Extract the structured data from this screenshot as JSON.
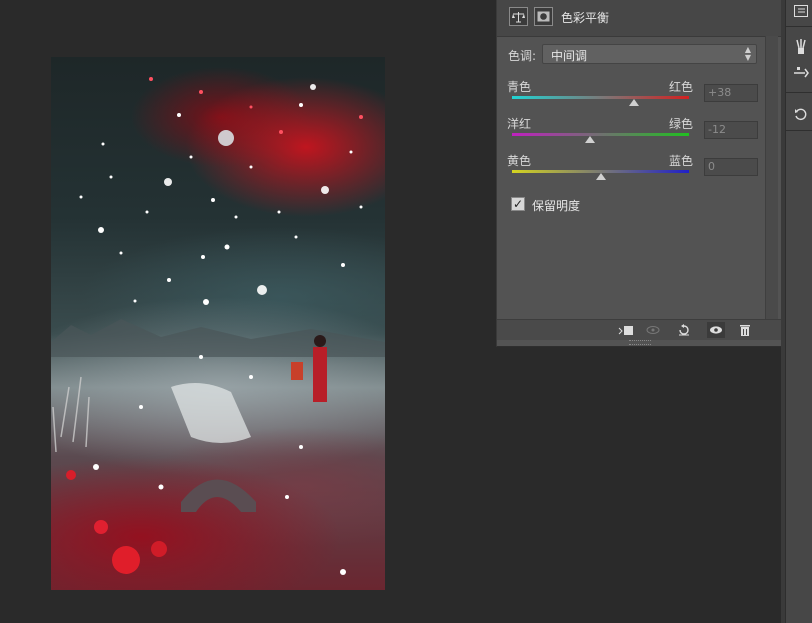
{
  "panel": {
    "title": "色彩平衡",
    "tone_label": "色调:",
    "tone_value": "中间调",
    "sliders": [
      {
        "left": "青色",
        "right": "红色",
        "value": "+38",
        "level": 38
      },
      {
        "left": "洋红",
        "right": "绿色",
        "value": "-12",
        "level": -12
      },
      {
        "left": "黄色",
        "right": "蓝色",
        "value": "0",
        "level": 0
      }
    ],
    "preserve_luminosity": {
      "label": "保留明度",
      "checked": true
    }
  },
  "icons": {
    "header": [
      "balance-scale-icon",
      "layer-mask-icon"
    ],
    "footer": [
      "clip-to-layer-icon",
      "view-previous-state-icon",
      "reset-icon",
      "visibility-eye-icon",
      "delete-trash-icon"
    ],
    "toolbar": [
      "properties-icon",
      "brush-presets-icon",
      "tool-presets-icon",
      "history-icon"
    ]
  },
  "colors": {
    "cyan": "#21d4d4",
    "red": "#d22020",
    "magenta": "#c020c0",
    "green": "#20c020",
    "yellow": "#d4d420",
    "blue": "#2020c8"
  }
}
